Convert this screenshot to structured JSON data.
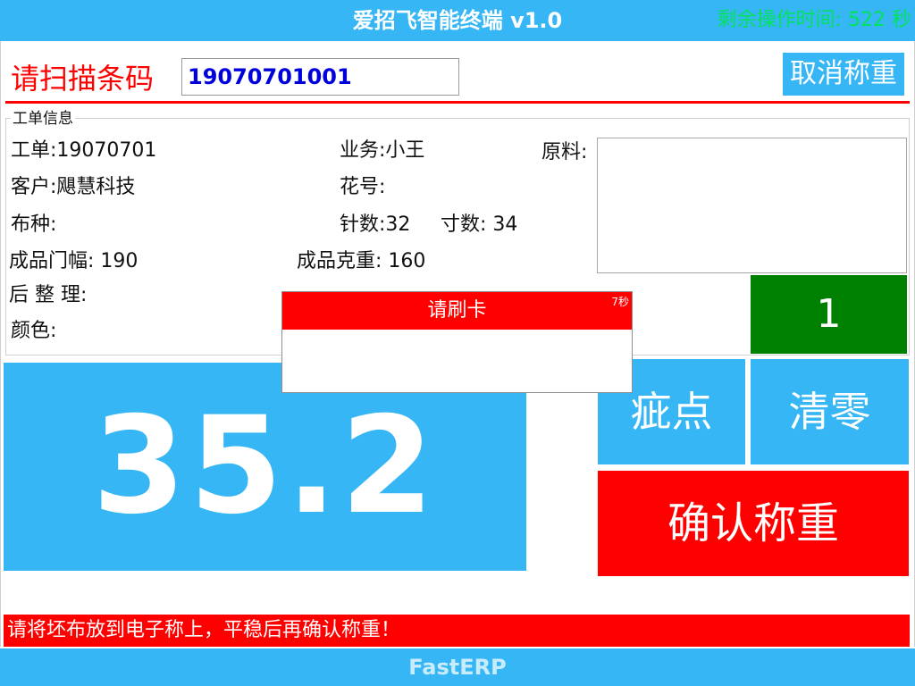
{
  "window": {
    "title": "爱招飞智能终端 v1.0",
    "timer": "剩余操作时间: 522 秒"
  },
  "scan": {
    "label": "请扫描条码",
    "value": "19070701001"
  },
  "toolbar": {
    "cancel_weigh_label": "取消称重"
  },
  "order_info": {
    "legend": "工单信息",
    "order_no": {
      "label": "工单:",
      "value": "19070701"
    },
    "salesman": {
      "label": "业务:",
      "value": "小王"
    },
    "material": {
      "label": "原料:"
    },
    "customer": {
      "label": "客户:",
      "value": "飓慧科技"
    },
    "pattern_no": {
      "label": "花号:",
      "value": ""
    },
    "fabric": {
      "label": "布种:",
      "value": ""
    },
    "needles": {
      "label": "针数:",
      "value": "32"
    },
    "gauge": {
      "label": "寸数:",
      "value": "34"
    },
    "finished_width": {
      "label": "成品门幅:",
      "value": "190"
    },
    "finished_weight": {
      "label": "成品克重:",
      "value": "160"
    },
    "finishing": {
      "label": "后 整 理:",
      "value": ""
    },
    "color": {
      "label": "颜色:",
      "value": ""
    }
  },
  "counter": {
    "value": "1"
  },
  "weight": {
    "value": "35.2"
  },
  "actions": {
    "defect_label": "疵点",
    "zero_label": "清零",
    "confirm_label": "确认称重"
  },
  "hint": {
    "text": "请将坯布放到电子称上，平稳后再确认称重！"
  },
  "footer": {
    "brand": "FastERP"
  },
  "dialog": {
    "title": "请刷卡",
    "countdown": "7秒"
  },
  "colors": {
    "primary": "#36b6f4",
    "danger": "#ff0000",
    "success": "#008000",
    "timer": "#00e35a",
    "scan_value": "#0000dd"
  }
}
